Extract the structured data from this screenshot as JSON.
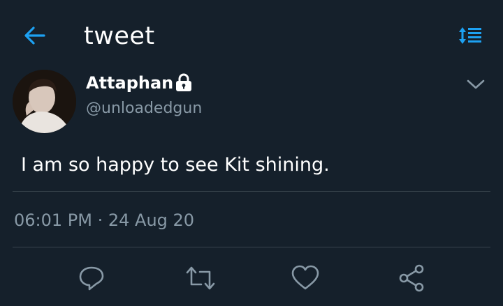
{
  "header": {
    "title": "tweet",
    "back_icon": "arrow-left-icon",
    "sort_icon": "sort-icon",
    "accent": "#1da1f2"
  },
  "tweet": {
    "author_name": "Attaphan",
    "author_handle": "@unloadedgun",
    "protected_icon": "lock-icon",
    "text": "I am so happy to see Kit shining.",
    "timestamp": "06:01 PM · 24 Aug 20"
  },
  "actions": [
    {
      "icon": "reply-icon"
    },
    {
      "icon": "retweet-icon"
    },
    {
      "icon": "like-icon"
    },
    {
      "icon": "share-icon"
    }
  ],
  "colors": {
    "background": "#15202b",
    "secondary_text": "#8899a6",
    "divider": "#38444d"
  }
}
